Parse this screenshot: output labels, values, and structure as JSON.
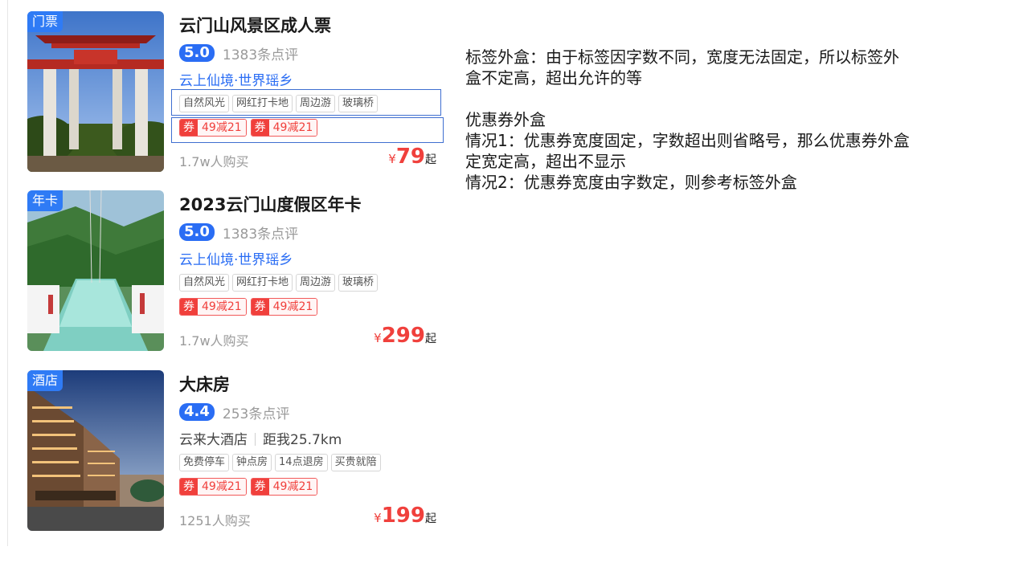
{
  "cards": [
    {
      "corner_tag": "门票",
      "title": "云门山风景区成人票",
      "score": "5.0",
      "reviews": "1383条点评",
      "subtitle": "云上仙境·世界瑶乡",
      "tags": [
        "自然风光",
        "网红打卡地",
        "周边游",
        "玻璃桥"
      ],
      "coupons": [
        {
          "badge": "券",
          "text": "49减21"
        },
        {
          "badge": "券",
          "text": "49减21"
        }
      ],
      "sold": "1.7w人购买",
      "currency": "¥",
      "price": "79",
      "price_suffix": "起",
      "image": "temple-gate-photo"
    },
    {
      "corner_tag": "年卡",
      "title": "2023云门山度假区年卡",
      "score": "5.0",
      "reviews": "1383条点评",
      "subtitle": "云上仙境·世界瑶乡",
      "tags": [
        "自然风光",
        "网红打卡地",
        "周边游",
        "玻璃桥"
      ],
      "coupons": [
        {
          "badge": "券",
          "text": "49减21"
        },
        {
          "badge": "券",
          "text": "49减21"
        }
      ],
      "sold": "1.7w人购买",
      "currency": "¥",
      "price": "299",
      "price_suffix": "起",
      "image": "glass-bridge-photo"
    },
    {
      "corner_tag": "酒店",
      "title": "大床房",
      "score": "4.4",
      "reviews": "253条点评",
      "subtitle_left": "云来大酒店",
      "subtitle_right": "距我25.7km",
      "tags": [
        "免费停车",
        "钟点房",
        "14点退房",
        "买贵就陪"
      ],
      "coupons": [
        {
          "badge": "券",
          "text": "49减21"
        },
        {
          "badge": "券",
          "text": "49减21"
        }
      ],
      "sold": "1251人购买",
      "currency": "¥",
      "price": "199",
      "price_suffix": "起",
      "image": "hotel-building-photo"
    }
  ],
  "notes": {
    "line1": "标签外盒：由于标签因字数不同，宽度无法固定，所以标签外",
    "line2": "盒不定高，超出允许的等",
    "line3": "优惠券外盒",
    "line4": "情况1：优惠券宽度固定，字数超出则省略号，那么优惠券外盒",
    "line5": "定宽定高，超出不显示",
    "line6": "情况2：优惠券宽度由字数定，则参考标签外盒"
  },
  "colors": {
    "brand_blue": "#2a6df4",
    "price_red": "#f0403c",
    "outline_blue": "#3f6fd0"
  }
}
